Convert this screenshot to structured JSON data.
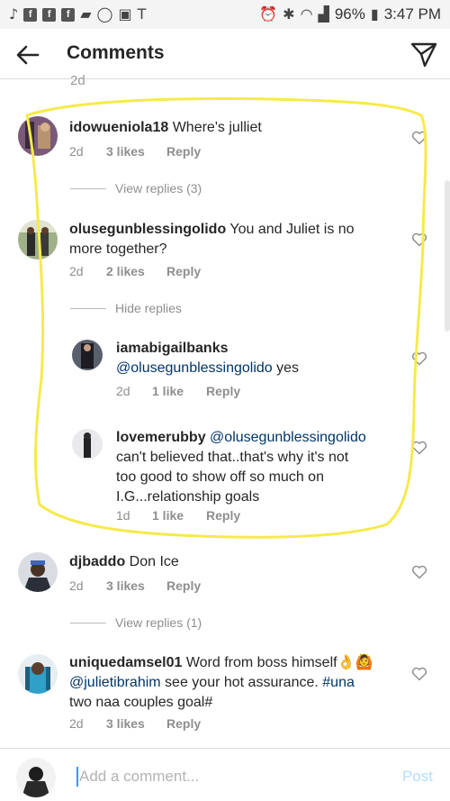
{
  "status_bar": {
    "battery": "96%",
    "time": "3:47 PM"
  },
  "header": {
    "title": "Comments"
  },
  "cut_off_text": "2d",
  "comments": [
    {
      "username": "idowueniola18",
      "text": " Where's julliet",
      "time": "2d",
      "likes": "3 likes",
      "reply_label": "Reply",
      "replies_toggle": "View replies (3)"
    },
    {
      "username": "olusegunblessingolido",
      "text_line1": " You and Juliet is no",
      "text_line2": "more together?",
      "time": "2d",
      "likes": "2 likes",
      "reply_label": "Reply",
      "replies_toggle": "Hide replies",
      "replies": [
        {
          "username": "iamabigailbanks",
          "mention": "@olusegunblessingolido",
          "text": " yes",
          "time": "2d",
          "likes": "1 like",
          "reply_label": "Reply"
        },
        {
          "username": "lovemerubby",
          "mention": "@olusegunblessingolido",
          "text_line2": "can't believed that..that's why it's not",
          "text_line3": "too good to show off so much on",
          "text_line4": "I.G...relationship goals",
          "time": "1d",
          "likes": "1 like",
          "reply_label": "Reply"
        }
      ]
    },
    {
      "username": "djbaddo",
      "text": " Don Ice",
      "time": "2d",
      "likes": "3 likes",
      "reply_label": "Reply",
      "replies_toggle": "View replies (1)"
    },
    {
      "username": "uniquedamsel01",
      "text_line1": " Word from boss himself",
      "emoji": "👌🙆",
      "mention": "@julietibrahim",
      "text_line2": " see your hot assurance. ",
      "hashtag": "#una",
      "text_line3": "two naa couples goal#",
      "time": "2d",
      "likes": "3 likes",
      "reply_label": "Reply"
    }
  ],
  "composer": {
    "placeholder": "Add a comment...",
    "post_label": "Post"
  },
  "colors": {
    "highlight": "#f6ea4b",
    "link": "#003569",
    "post_disabled": "#b2dffc"
  }
}
